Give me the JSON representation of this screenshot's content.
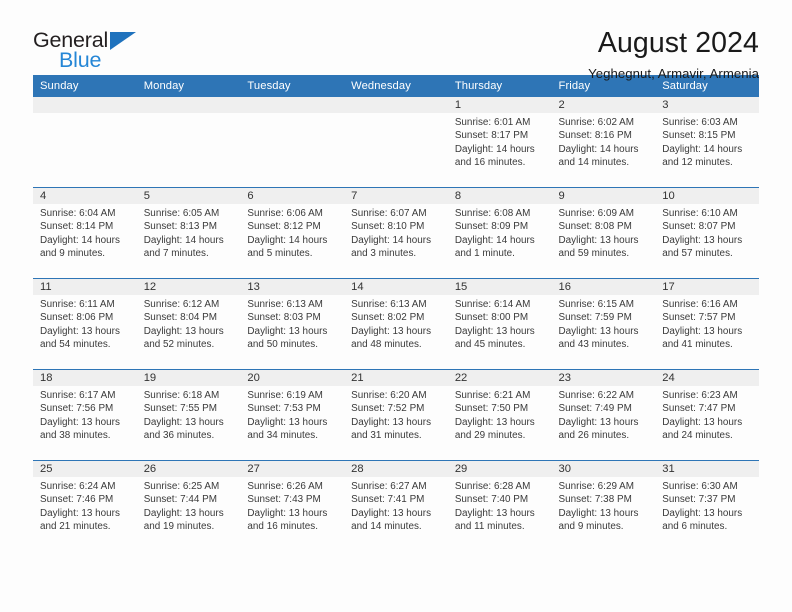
{
  "brand": {
    "name_part1": "General",
    "name_part2": "Blue",
    "accent_color": "#2586d6",
    "triangle_color": "#1f72bd"
  },
  "header": {
    "title": "August 2024",
    "subtitle": "Yeghegnut, Armavir, Armenia"
  },
  "calendar": {
    "header_bg": "#2e75b6",
    "weekday_headers": [
      "Sunday",
      "Monday",
      "Tuesday",
      "Wednesday",
      "Thursday",
      "Friday",
      "Saturday"
    ],
    "labels": {
      "sunrise": "Sunrise:",
      "sunset": "Sunset:",
      "daylight": "Daylight:"
    },
    "weeks": [
      [
        {
          "day": "",
          "empty": true
        },
        {
          "day": "",
          "empty": true
        },
        {
          "day": "",
          "empty": true
        },
        {
          "day": "",
          "empty": true
        },
        {
          "day": "1",
          "sunrise": "Sunrise: 6:01 AM",
          "sunset": "Sunset: 8:17 PM",
          "daylight": "Daylight: 14 hours and 16 minutes."
        },
        {
          "day": "2",
          "sunrise": "Sunrise: 6:02 AM",
          "sunset": "Sunset: 8:16 PM",
          "daylight": "Daylight: 14 hours and 14 minutes."
        },
        {
          "day": "3",
          "sunrise": "Sunrise: 6:03 AM",
          "sunset": "Sunset: 8:15 PM",
          "daylight": "Daylight: 14 hours and 12 minutes."
        }
      ],
      [
        {
          "day": "4",
          "sunrise": "Sunrise: 6:04 AM",
          "sunset": "Sunset: 8:14 PM",
          "daylight": "Daylight: 14 hours and 9 minutes."
        },
        {
          "day": "5",
          "sunrise": "Sunrise: 6:05 AM",
          "sunset": "Sunset: 8:13 PM",
          "daylight": "Daylight: 14 hours and 7 minutes."
        },
        {
          "day": "6",
          "sunrise": "Sunrise: 6:06 AM",
          "sunset": "Sunset: 8:12 PM",
          "daylight": "Daylight: 14 hours and 5 minutes."
        },
        {
          "day": "7",
          "sunrise": "Sunrise: 6:07 AM",
          "sunset": "Sunset: 8:10 PM",
          "daylight": "Daylight: 14 hours and 3 minutes."
        },
        {
          "day": "8",
          "sunrise": "Sunrise: 6:08 AM",
          "sunset": "Sunset: 8:09 PM",
          "daylight": "Daylight: 14 hours and 1 minute."
        },
        {
          "day": "9",
          "sunrise": "Sunrise: 6:09 AM",
          "sunset": "Sunset: 8:08 PM",
          "daylight": "Daylight: 13 hours and 59 minutes."
        },
        {
          "day": "10",
          "sunrise": "Sunrise: 6:10 AM",
          "sunset": "Sunset: 8:07 PM",
          "daylight": "Daylight: 13 hours and 57 minutes."
        }
      ],
      [
        {
          "day": "11",
          "sunrise": "Sunrise: 6:11 AM",
          "sunset": "Sunset: 8:06 PM",
          "daylight": "Daylight: 13 hours and 54 minutes."
        },
        {
          "day": "12",
          "sunrise": "Sunrise: 6:12 AM",
          "sunset": "Sunset: 8:04 PM",
          "daylight": "Daylight: 13 hours and 52 minutes."
        },
        {
          "day": "13",
          "sunrise": "Sunrise: 6:13 AM",
          "sunset": "Sunset: 8:03 PM",
          "daylight": "Daylight: 13 hours and 50 minutes."
        },
        {
          "day": "14",
          "sunrise": "Sunrise: 6:13 AM",
          "sunset": "Sunset: 8:02 PM",
          "daylight": "Daylight: 13 hours and 48 minutes."
        },
        {
          "day": "15",
          "sunrise": "Sunrise: 6:14 AM",
          "sunset": "Sunset: 8:00 PM",
          "daylight": "Daylight: 13 hours and 45 minutes."
        },
        {
          "day": "16",
          "sunrise": "Sunrise: 6:15 AM",
          "sunset": "Sunset: 7:59 PM",
          "daylight": "Daylight: 13 hours and 43 minutes."
        },
        {
          "day": "17",
          "sunrise": "Sunrise: 6:16 AM",
          "sunset": "Sunset: 7:57 PM",
          "daylight": "Daylight: 13 hours and 41 minutes."
        }
      ],
      [
        {
          "day": "18",
          "sunrise": "Sunrise: 6:17 AM",
          "sunset": "Sunset: 7:56 PM",
          "daylight": "Daylight: 13 hours and 38 minutes."
        },
        {
          "day": "19",
          "sunrise": "Sunrise: 6:18 AM",
          "sunset": "Sunset: 7:55 PM",
          "daylight": "Daylight: 13 hours and 36 minutes."
        },
        {
          "day": "20",
          "sunrise": "Sunrise: 6:19 AM",
          "sunset": "Sunset: 7:53 PM",
          "daylight": "Daylight: 13 hours and 34 minutes."
        },
        {
          "day": "21",
          "sunrise": "Sunrise: 6:20 AM",
          "sunset": "Sunset: 7:52 PM",
          "daylight": "Daylight: 13 hours and 31 minutes."
        },
        {
          "day": "22",
          "sunrise": "Sunrise: 6:21 AM",
          "sunset": "Sunset: 7:50 PM",
          "daylight": "Daylight: 13 hours and 29 minutes."
        },
        {
          "day": "23",
          "sunrise": "Sunrise: 6:22 AM",
          "sunset": "Sunset: 7:49 PM",
          "daylight": "Daylight: 13 hours and 26 minutes."
        },
        {
          "day": "24",
          "sunrise": "Sunrise: 6:23 AM",
          "sunset": "Sunset: 7:47 PM",
          "daylight": "Daylight: 13 hours and 24 minutes."
        }
      ],
      [
        {
          "day": "25",
          "sunrise": "Sunrise: 6:24 AM",
          "sunset": "Sunset: 7:46 PM",
          "daylight": "Daylight: 13 hours and 21 minutes."
        },
        {
          "day": "26",
          "sunrise": "Sunrise: 6:25 AM",
          "sunset": "Sunset: 7:44 PM",
          "daylight": "Daylight: 13 hours and 19 minutes."
        },
        {
          "day": "27",
          "sunrise": "Sunrise: 6:26 AM",
          "sunset": "Sunset: 7:43 PM",
          "daylight": "Daylight: 13 hours and 16 minutes."
        },
        {
          "day": "28",
          "sunrise": "Sunrise: 6:27 AM",
          "sunset": "Sunset: 7:41 PM",
          "daylight": "Daylight: 13 hours and 14 minutes."
        },
        {
          "day": "29",
          "sunrise": "Sunrise: 6:28 AM",
          "sunset": "Sunset: 7:40 PM",
          "daylight": "Daylight: 13 hours and 11 minutes."
        },
        {
          "day": "30",
          "sunrise": "Sunrise: 6:29 AM",
          "sunset": "Sunset: 7:38 PM",
          "daylight": "Daylight: 13 hours and 9 minutes."
        },
        {
          "day": "31",
          "sunrise": "Sunrise: 6:30 AM",
          "sunset": "Sunset: 7:37 PM",
          "daylight": "Daylight: 13 hours and 6 minutes."
        }
      ]
    ]
  }
}
